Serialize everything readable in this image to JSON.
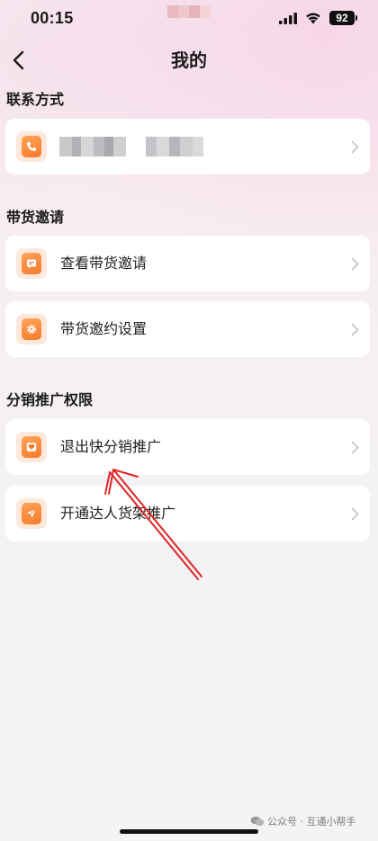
{
  "status_bar": {
    "time": "00:15",
    "battery": "92"
  },
  "nav": {
    "title": "我的"
  },
  "sections": [
    {
      "title": "联系方式",
      "items": [
        {
          "label": "",
          "icon": "phone-icon",
          "masked": true
        }
      ]
    },
    {
      "title": "带货邀请",
      "items": [
        {
          "label": "查看带货邀请",
          "icon": "message-icon"
        },
        {
          "label": "带货邀约设置",
          "icon": "settings-icon"
        }
      ]
    },
    {
      "title": "分销推广权限",
      "items": [
        {
          "label": "退出快分销推广",
          "icon": "heart-icon"
        },
        {
          "label": "开通达人货架推广",
          "icon": "send-icon"
        }
      ]
    }
  ],
  "watermark": {
    "text": "公众号 · 互通小帮手"
  },
  "colors": {
    "accent": "#f57a2c",
    "icon_bg": "#fde8dc",
    "annotation": "#e02424"
  }
}
